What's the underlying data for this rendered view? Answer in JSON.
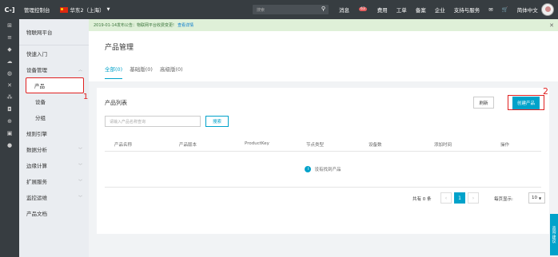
{
  "topbar": {
    "logo": "C-]",
    "title": "管理控制台",
    "region": "华东2（上海）",
    "search_placeholder": "搜索",
    "messages_label": "消息",
    "messages_count": "63",
    "fees": "费用",
    "tickets": "工单",
    "filing": "备案",
    "enterprise": "企业",
    "support": "支持与服务",
    "language": "简体中文"
  },
  "sidenav": {
    "header": "物联网平台",
    "quick_start": "快速入门",
    "device_mgmt": "设备管理",
    "sub_product": "产品",
    "sub_device": "设备",
    "sub_group": "分组",
    "rule_engine": "规则引擎",
    "data_analysis": "数据分析",
    "edge": "边缘计算",
    "extensions": "扩展服务",
    "ops": "监控运维",
    "docs": "产品文档"
  },
  "annotations": {
    "mark1": "1",
    "mark2": "2"
  },
  "notice": {
    "text": "2019-01-14发布公告：物联网平台收费变更!",
    "link": "查看详情"
  },
  "page": {
    "title": "产品管理",
    "tabs": [
      "全部(0)",
      "基础版(0)",
      "高级版(0)"
    ]
  },
  "card": {
    "title": "产品列表",
    "refresh": "刷新",
    "create": "创建产品",
    "search_placeholder": "请输入产品名称查询",
    "search_button": "搜索",
    "columns": [
      "产品名称",
      "产品版本",
      "ProductKey",
      "节点类型",
      "设备数",
      "添加时间",
      "操作"
    ],
    "empty": "没有找到产品"
  },
  "pager": {
    "total": "共有 0 条",
    "current": "1",
    "page_size_label": "每页显示:",
    "page_size": "10"
  },
  "float_button": "咨询·建议"
}
